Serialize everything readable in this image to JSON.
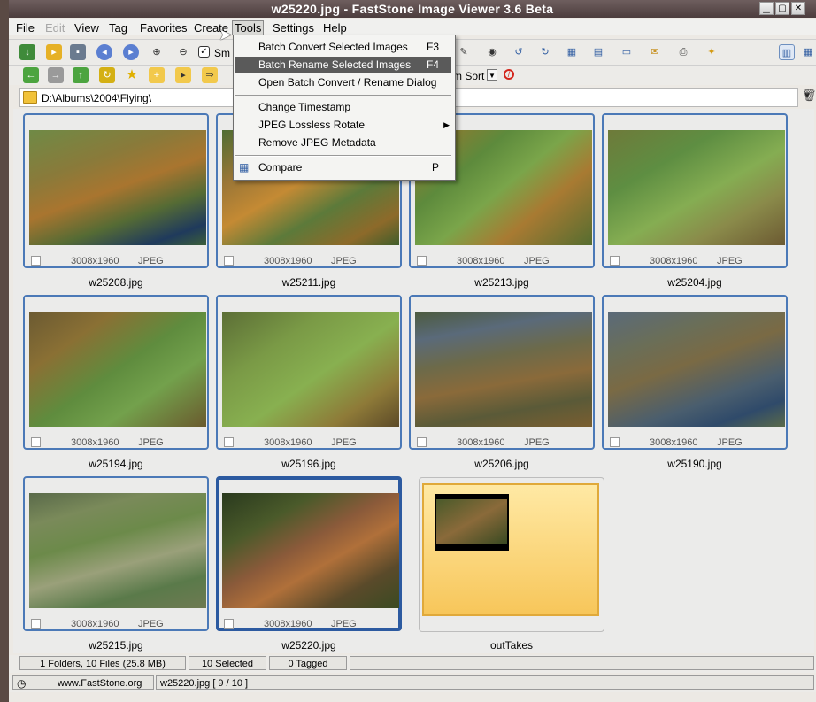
{
  "window": {
    "title": "w25220.jpg  -  FastStone Image Viewer 3.6 Beta"
  },
  "menubar": {
    "items": [
      {
        "label": "File"
      },
      {
        "label": "Edit"
      },
      {
        "label": "View"
      },
      {
        "label": "Tag"
      },
      {
        "label": "Favorites"
      },
      {
        "label": "Create"
      },
      {
        "label": "Tools"
      },
      {
        "label": "Settings"
      },
      {
        "label": "Help"
      }
    ]
  },
  "toolbar": {
    "smooth_label": "Sm",
    "sort_label": "m Sort"
  },
  "path": {
    "value": "D:\\Albums\\2004\\Flying\\"
  },
  "tools_menu": {
    "items": [
      {
        "label": "Batch Convert Selected Images",
        "shortcut": "F3"
      },
      {
        "label": "Batch Rename Selected Images",
        "shortcut": "F4"
      },
      {
        "label": "Open Batch Convert / Rename Dialog",
        "shortcut": ""
      },
      {
        "label": "Change Timestamp",
        "shortcut": ""
      },
      {
        "label": "JPEG Lossless Rotate",
        "shortcut": ""
      },
      {
        "label": "Remove JPEG Metadata",
        "shortcut": ""
      },
      {
        "label": "Compare",
        "shortcut": "P"
      }
    ]
  },
  "thumbnails": [
    {
      "name": "w25208.jpg",
      "dims": "3008x1960",
      "type": "JPEG"
    },
    {
      "name": "w25211.jpg",
      "dims": "3008x1960",
      "type": "JPEG"
    },
    {
      "name": "w25213.jpg",
      "dims": "3008x1960",
      "type": "JPEG"
    },
    {
      "name": "w25204.jpg",
      "dims": "3008x1960",
      "type": "JPEG"
    },
    {
      "name": "w25194.jpg",
      "dims": "3008x1960",
      "type": "JPEG"
    },
    {
      "name": "w25196.jpg",
      "dims": "3008x1960",
      "type": "JPEG"
    },
    {
      "name": "w25206.jpg",
      "dims": "3008x1960",
      "type": "JPEG"
    },
    {
      "name": "w25190.jpg",
      "dims": "3008x1960",
      "type": "JPEG"
    },
    {
      "name": "w25215.jpg",
      "dims": "3008x1960",
      "type": "JPEG"
    },
    {
      "name": "w25220.jpg",
      "dims": "3008x1960",
      "type": "JPEG"
    }
  ],
  "folder": {
    "name": "outTakes"
  },
  "status": {
    "summary": "1 Folders, 10 Files (25.8 MB)",
    "selected": "10 Selected",
    "tagged": "0 Tagged",
    "website": "www.FastStone.org",
    "current": "w25220.jpg [ 9 / 10 ]"
  },
  "colors": {
    "selection_border": "#2c5aa0",
    "thumb_border": "#4b79b7",
    "menu_highlight": "#5a5a5a"
  }
}
